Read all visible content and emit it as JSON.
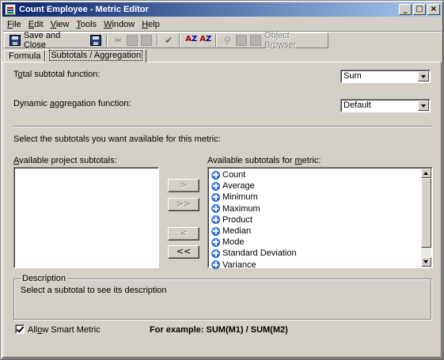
{
  "window": {
    "title": "Count Employee - Metric Editor"
  },
  "title_buttons": {
    "minimize": "_",
    "maximize": "□",
    "close": "×"
  },
  "menu": [
    {
      "key": "F",
      "rest": "ile"
    },
    {
      "key": "E",
      "rest": "dit"
    },
    {
      "key": "V",
      "rest": "iew"
    },
    {
      "key": "T",
      "rest": "ools"
    },
    {
      "key": "W",
      "rest": "indow"
    },
    {
      "key": "H",
      "rest": "elp"
    }
  ],
  "toolbar": {
    "save_close_label": "Save and Close",
    "object_browser_label": "Object Browser"
  },
  "tabs": [
    {
      "label": "Formula"
    },
    {
      "label": "Subtotals / Aggregation"
    }
  ],
  "form": {
    "total_subtotal": {
      "label_prefix": "T",
      "label_key": "o",
      "label_rest": "tal subtotal function:",
      "value": "Sum"
    },
    "dynamic_aggregation": {
      "label_prefix": "Dynamic ",
      "label_key": "a",
      "label_rest": "ggregation function:",
      "value": "Default"
    },
    "select_instruction": "Select the subtotals you want available for this metric:",
    "available_project": {
      "label_key": "A",
      "label_rest": "vailable project subtotals:"
    },
    "available_metric": {
      "label_prefix": "Available subtotals for ",
      "label_key": "m",
      "label_rest": "etric:"
    },
    "metric_subtotals": [
      "Count",
      "Average",
      "Minimum",
      "Maximum",
      "Product",
      "Median",
      "Mode",
      "Standard Deviation",
      "Variance"
    ],
    "move_buttons": {
      "add": ">",
      "add_all": ">>",
      "remove": "<",
      "remove_all": "<<"
    },
    "description": {
      "title": "Description",
      "text": "Select a subtotal to see its description"
    },
    "smart_metric": {
      "label_prefix": "All",
      "label_key": "o",
      "label_rest": "w Smart Metric",
      "checked": true
    },
    "example": "For example: SUM(M1) / SUM(M2)"
  }
}
